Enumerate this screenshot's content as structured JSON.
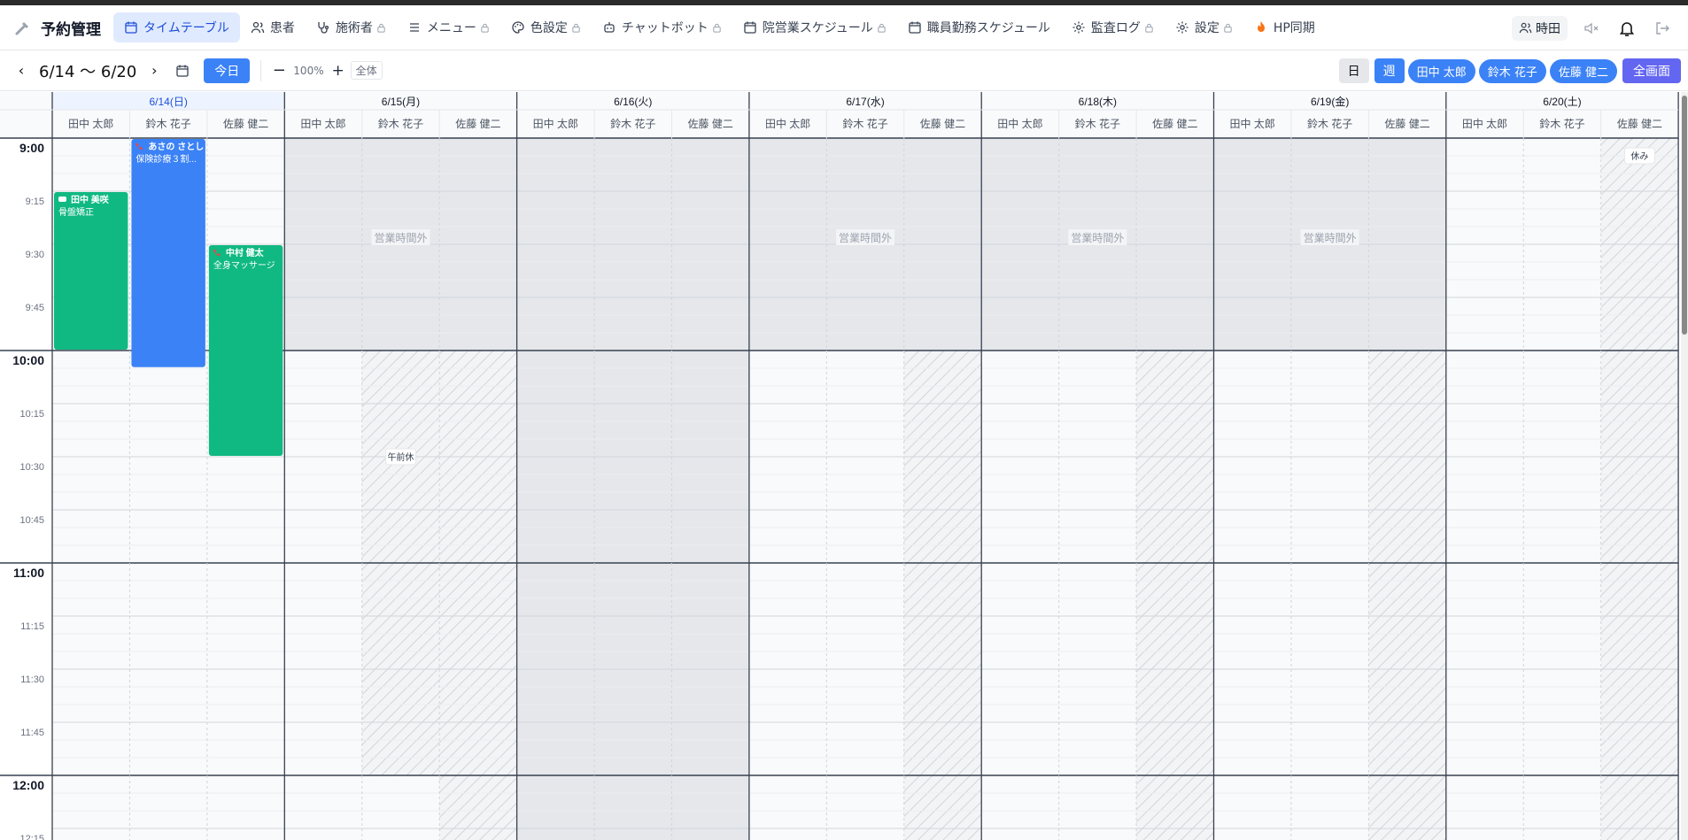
{
  "app": {
    "title": "予約管理"
  },
  "nav": [
    {
      "label": "タイムテーブル",
      "icon": "calendar-icon",
      "active": true,
      "locked": false
    },
    {
      "label": "患者",
      "icon": "users-icon",
      "active": false,
      "locked": false
    },
    {
      "label": "施術者",
      "icon": "stethoscope-icon",
      "active": false,
      "locked": true
    },
    {
      "label": "メニュー",
      "icon": "list-icon",
      "active": false,
      "locked": true
    },
    {
      "label": "色設定",
      "icon": "palette-icon",
      "active": false,
      "locked": true
    },
    {
      "label": "チャットボット",
      "icon": "bot-icon",
      "active": false,
      "locked": true
    },
    {
      "label": "院営業スケジュール",
      "icon": "calendar-icon",
      "active": false,
      "locked": true
    },
    {
      "label": "職員勤務スケジュール",
      "icon": "calendar-icon",
      "active": false,
      "locked": false
    },
    {
      "label": "監査ログ",
      "icon": "gear-icon",
      "active": false,
      "locked": true
    },
    {
      "label": "設定",
      "icon": "gear-icon",
      "active": false,
      "locked": true
    },
    {
      "label": "HP同期",
      "icon": "fire-icon",
      "active": false,
      "locked": false
    }
  ],
  "user": {
    "name": "時田"
  },
  "toolbar": {
    "range": "6/14 〜 6/20",
    "today": "今日",
    "zoom_minus": "−",
    "zoom": "100%",
    "zoom_plus": "+",
    "all": "全体",
    "day": "日",
    "week": "週",
    "staff_pills": [
      "田中 太郎",
      "鈴木 花子",
      "佐藤 健二"
    ],
    "fullscreen": "全画面"
  },
  "calendar": {
    "days": [
      {
        "label": "6/14(日)",
        "today": true
      },
      {
        "label": "6/15(月)",
        "today": false
      },
      {
        "label": "6/16(火)",
        "today": false
      },
      {
        "label": "6/17(水)",
        "today": false
      },
      {
        "label": "6/18(木)",
        "today": false
      },
      {
        "label": "6/19(金)",
        "today": false
      },
      {
        "label": "6/20(土)",
        "today": false
      }
    ],
    "staff": [
      "田中 太郎",
      "鈴木 花子",
      "佐藤 健二"
    ],
    "times": [
      "9:00",
      "9:15",
      "9:30",
      "9:45",
      "10:00",
      "10:15",
      "10:30",
      "10:45",
      "11:00",
      "11:15",
      "11:30",
      "11:45",
      "12:00",
      "12:15"
    ],
    "closed_label": "営業時間外",
    "am_off_label": "午前休",
    "off_label": "休み",
    "closed": [
      {
        "day": 1,
        "start": 0,
        "end": 4,
        "label": true
      },
      {
        "day": 2,
        "start": 0,
        "end": 14,
        "label": false
      },
      {
        "day": 3,
        "start": 0,
        "end": 4,
        "label": true
      },
      {
        "day": 4,
        "start": 0,
        "end": 4,
        "label": true
      },
      {
        "day": 5,
        "start": 0,
        "end": 4,
        "label": true
      }
    ],
    "hatched": [
      {
        "day": 1,
        "staff": 1,
        "start": 4,
        "end": 12,
        "label": "am_off"
      },
      {
        "day": 1,
        "staff": 2,
        "start": 4,
        "end": 14,
        "label": ""
      },
      {
        "day": 3,
        "staff": 2,
        "start": 4,
        "end": 14,
        "label": ""
      },
      {
        "day": 4,
        "staff": 2,
        "start": 4,
        "end": 14,
        "label": ""
      },
      {
        "day": 5,
        "staff": 2,
        "start": 4,
        "end": 14,
        "label": ""
      },
      {
        "day": 6,
        "staff": 2,
        "start": 0,
        "end": 14,
        "label": "off"
      }
    ],
    "appointments": [
      {
        "day": 0,
        "staff": 0,
        "start": 1,
        "end": 4,
        "name": "田中 美咲",
        "menu": "骨盤矯正",
        "color": "#10b981",
        "icon": "chat-icon"
      },
      {
        "day": 0,
        "staff": 1,
        "start": 0,
        "end": 4.33,
        "name": "あさの さとし",
        "menu": "保険診療３割...",
        "color": "#3b82f6",
        "icon": "phone-icon"
      },
      {
        "day": 0,
        "staff": 2,
        "start": 2,
        "end": 6,
        "name": "中村 健太",
        "menu": "全身マッサージ",
        "color": "#10b981",
        "icon": "phone-icon"
      }
    ]
  },
  "colors": {
    "accent": "#3b82f6",
    "active_nav_bg": "#e0eaff",
    "green": "#10b981",
    "closed_bg": "#e5e7eb",
    "fullscreen": "#6366f1"
  }
}
